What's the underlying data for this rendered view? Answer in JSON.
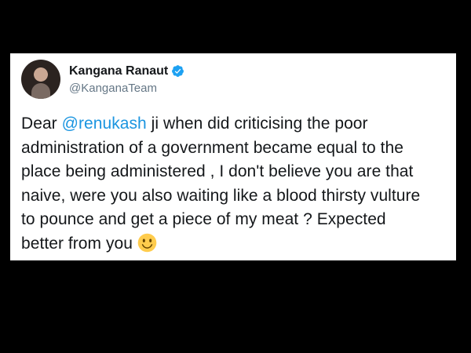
{
  "tweet": {
    "author_name": "Kangana Ranaut",
    "author_handle": "@KanganaTeam",
    "text_part1": "Dear ",
    "mention": "@renukash",
    "text_part2": " ji when did criticising the poor\nadministration of a government became equal to the\nplace being administered , I don't believe you are that\nnaive, were you also waiting like a blood thirsty vulture\nto pounce and get a piece of my meat ? Expected\nbetter from you",
    "emoji": "slightly-smiling-face",
    "verified_icon": "verified-badge-icon",
    "colors": {
      "background": "#000000",
      "card": "#ffffff",
      "text": "#14171a",
      "handle": "#657786",
      "mention": "#1b95e0",
      "verified": "#1da1f2",
      "emoji": "#ffcc4d"
    }
  }
}
